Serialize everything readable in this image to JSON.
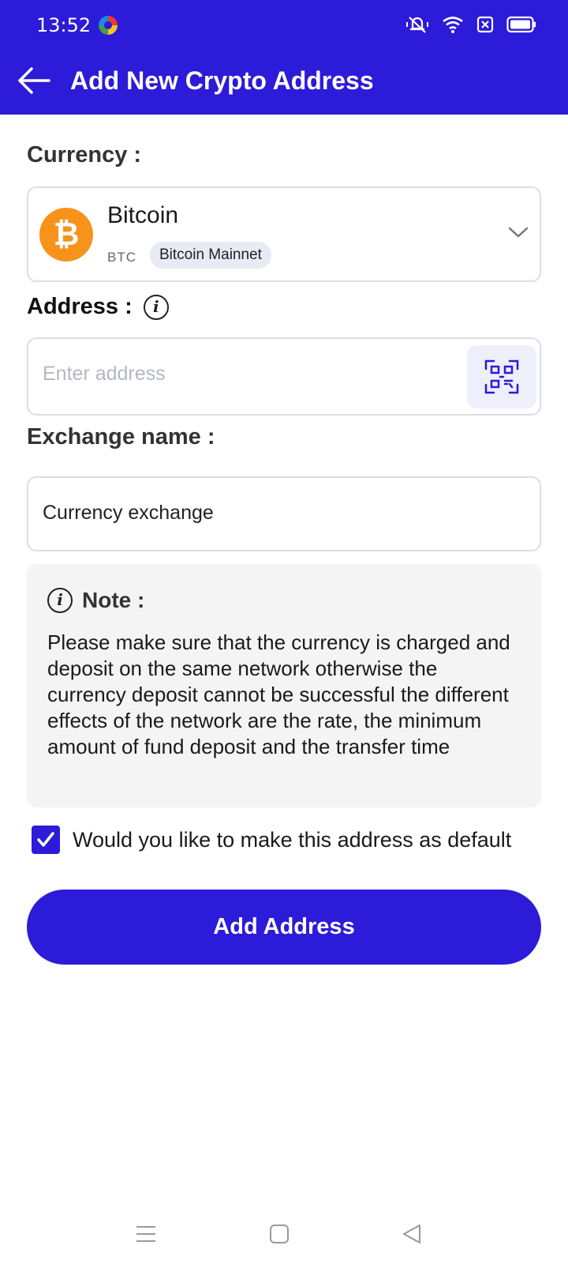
{
  "status_bar": {
    "time": "13:52",
    "icons": [
      "browser-icon",
      "muted-bell-icon",
      "wifi-icon",
      "sim-blocked-icon",
      "battery-icon"
    ]
  },
  "header": {
    "title": "Add New Crypto Address",
    "back_icon": "arrow-left-icon"
  },
  "currency": {
    "label": "Currency :",
    "name": "Bitcoin",
    "code": "BTC",
    "network": "Bitcoin Mainnet",
    "icon_symbol": "₿",
    "icon_color": "#f7931a"
  },
  "address": {
    "label": "Address :",
    "value": "",
    "placeholder": "Enter address",
    "scan_icon": "qr-scan-icon"
  },
  "exchange": {
    "label": "Exchange name :",
    "value": "Currency exchange"
  },
  "note": {
    "title": "Note :",
    "text": "Please make sure that the currency is charged and deposit on the same network otherwise the currency deposit cannot be successful the different effects of the network are the rate, the minimum amount of fund deposit and the transfer time"
  },
  "default_option": {
    "label": "Would you like to make this address as default",
    "checked": true
  },
  "submit": {
    "label": "Add Address"
  },
  "nav": {
    "icons": [
      "menu-icon",
      "home-square-icon",
      "back-triangle-icon"
    ]
  },
  "colors": {
    "primary": "#2c1bd8",
    "bitcoin": "#f7931a",
    "note_background": "#f4f4f5"
  }
}
